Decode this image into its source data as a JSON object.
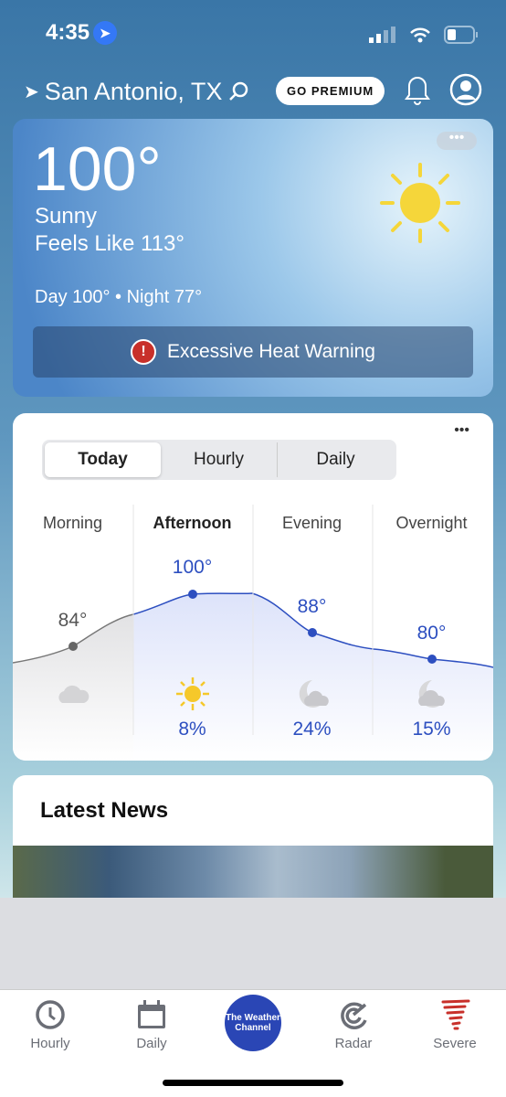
{
  "status": {
    "time": "4:35"
  },
  "header": {
    "location": "San Antonio, TX",
    "premium": "GO PREMIUM"
  },
  "current": {
    "temp": "100°",
    "condition": "Sunny",
    "feels_like": "Feels Like 113°",
    "day_night": "Day 100° • Night 77°",
    "alert": "Excessive Heat Warning",
    "more": "•••"
  },
  "forecast": {
    "tabs": [
      "Today",
      "Hourly",
      "Daily"
    ],
    "more": "•••",
    "periods": [
      {
        "name": "Morning",
        "temp": "84°",
        "precip": "",
        "icon": "cloud-icon"
      },
      {
        "name": "Afternoon",
        "temp": "100°",
        "precip": "8%",
        "icon": "sun-icon"
      },
      {
        "name": "Evening",
        "temp": "88°",
        "precip": "24%",
        "icon": "moon-cloud-icon"
      },
      {
        "name": "Overnight",
        "temp": "80°",
        "precip": "15%",
        "icon": "moon-cloud-icon"
      }
    ]
  },
  "news": {
    "title": "Latest News"
  },
  "nav": {
    "items": [
      "Hourly",
      "Daily",
      "Radar",
      "Severe"
    ],
    "logo": "The Weather Channel"
  },
  "colors": {
    "accent": "#2d4fc0",
    "alert": "#c8302a",
    "brand": "#2a46b5"
  }
}
